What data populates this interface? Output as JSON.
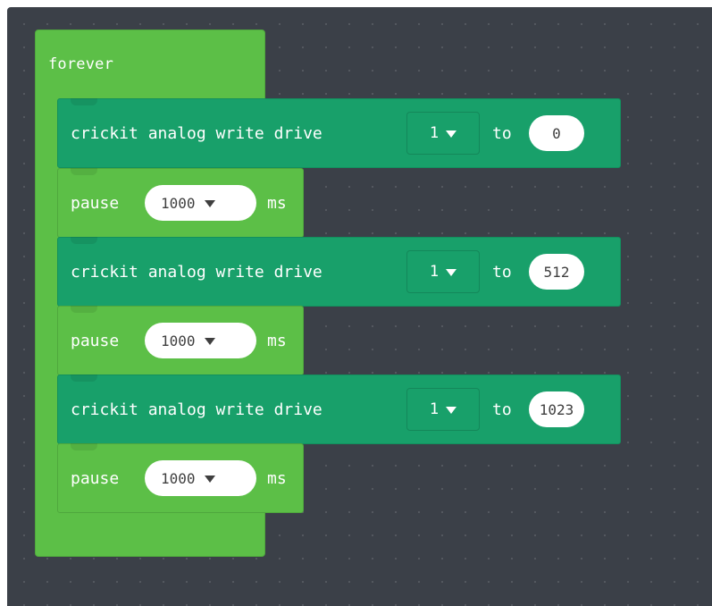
{
  "forever": {
    "label": "forever"
  },
  "statements": [
    {
      "type": "crickit",
      "label": "crickit analog write drive",
      "drive": "1",
      "to_label": "to",
      "value": "0"
    },
    {
      "type": "pause",
      "label": "pause",
      "duration": "1000",
      "unit": "ms"
    },
    {
      "type": "crickit",
      "label": "crickit analog write drive",
      "drive": "1",
      "to_label": "to",
      "value": "512"
    },
    {
      "type": "pause",
      "label": "pause",
      "duration": "1000",
      "unit": "ms"
    },
    {
      "type": "crickit",
      "label": "crickit analog write drive",
      "drive": "1",
      "to_label": "to",
      "value": "1023"
    },
    {
      "type": "pause",
      "label": "pause",
      "duration": "1000",
      "unit": "ms"
    }
  ],
  "colors": {
    "workspace": "#3b4048",
    "loops_green": "#5cbf47",
    "crickit_teal": "#18a06a"
  }
}
